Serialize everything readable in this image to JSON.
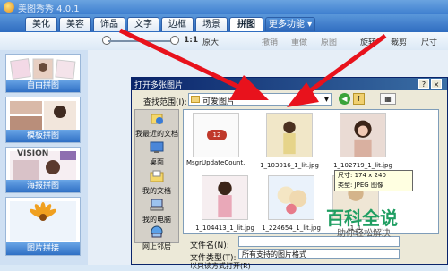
{
  "app": {
    "title": "美图秀秀 4.0.1"
  },
  "tabs": [
    {
      "label": "美化",
      "active": false
    },
    {
      "label": "美容",
      "active": false
    },
    {
      "label": "饰品",
      "active": false
    },
    {
      "label": "文字",
      "active": false
    },
    {
      "label": "边框",
      "active": false
    },
    {
      "label": "场景",
      "active": false
    },
    {
      "label": "拼图",
      "active": true
    },
    {
      "label": "更多功能 ▾",
      "active": false
    }
  ],
  "toolbar": {
    "zoom_ratio": "1:1",
    "original_size": "原大",
    "undo": "撤销",
    "redo": "重做",
    "reset": "原图",
    "rotate": "旋转",
    "crop": "裁剪",
    "resize": "尺寸"
  },
  "left_panel": {
    "items": [
      {
        "label": "自由拼图"
      },
      {
        "label": "模板拼图"
      },
      {
        "label": "海报拼图",
        "badge": "VISION"
      },
      {
        "label": "图片拼接"
      }
    ]
  },
  "dialog": {
    "title": "打开多张图片",
    "help": "?",
    "close": "×",
    "look_in_label": "查找范围(I):",
    "look_in_value": "可爱图片",
    "places": [
      {
        "label": "我最近的文档",
        "icon": "recent-documents-icon"
      },
      {
        "label": "桌面",
        "icon": "desktop-icon"
      },
      {
        "label": "我的文档",
        "icon": "my-documents-icon"
      },
      {
        "label": "我的电脑",
        "icon": "my-computer-icon"
      },
      {
        "label": "网上邻居",
        "icon": "network-places-icon"
      }
    ],
    "files": [
      {
        "name": "MsgrUpdateCount.png",
        "badge": "12"
      },
      {
        "name": "1_103016_1_lit.jpg"
      },
      {
        "name": "1_102719_1_lit.jpg"
      },
      {
        "name": "1_1"
      },
      {
        "name": "1_104413_1_lit.jpg"
      },
      {
        "name": "1_224654_1_lit.jpg"
      }
    ],
    "tooltip": {
      "dimensions": "尺寸: 174 x 240",
      "type": "类型: JPEG 图像"
    },
    "file_name_label": "文件名(N):",
    "file_name_value": "",
    "file_type_label": "文件类型(T):",
    "file_type_value": "所有支持的图片格式",
    "readonly_partial": "以只读方式打开(R)"
  },
  "watermark": {
    "main": "百科全说",
    "sub": "助你轻松解决"
  },
  "colors": {
    "accent_blue": "#2f6cc0",
    "arrow_red": "#e8121c",
    "watermark_green": "#1f9e62"
  }
}
